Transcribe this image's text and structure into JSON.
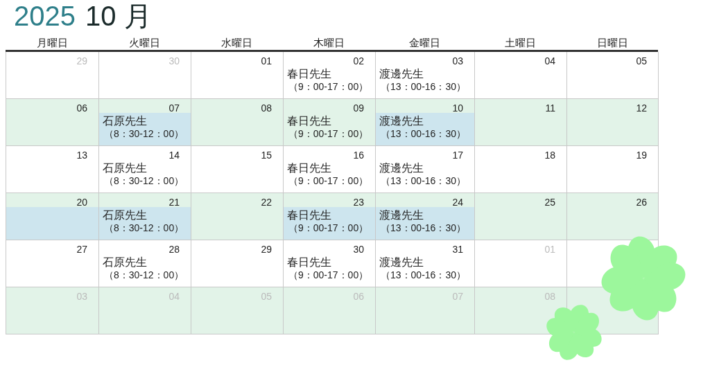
{
  "title": {
    "year": "2025",
    "month": "10 月"
  },
  "weekdays": [
    "月曜日",
    "火曜日",
    "水曜日",
    "木曜日",
    "金曜日",
    "土曜日",
    "日曜日"
  ],
  "weeks": [
    {
      "shaded": false,
      "days": [
        {
          "day": "29",
          "outside": true,
          "highlighted": false
        },
        {
          "day": "30",
          "outside": true,
          "highlighted": false
        },
        {
          "day": "01",
          "outside": false,
          "highlighted": false
        },
        {
          "day": "02",
          "outside": false,
          "highlighted": false,
          "event": {
            "name": "春日先生",
            "time": "（9：00-17：00）"
          }
        },
        {
          "day": "03",
          "outside": false,
          "highlighted": false,
          "event": {
            "name": "渡邊先生",
            "time": "（13：00-16：30）"
          }
        },
        {
          "day": "04",
          "outside": false,
          "highlighted": false
        },
        {
          "day": "05",
          "outside": false,
          "highlighted": false
        }
      ]
    },
    {
      "shaded": true,
      "days": [
        {
          "day": "06",
          "outside": false,
          "highlighted": false
        },
        {
          "day": "07",
          "outside": false,
          "highlighted": true,
          "event": {
            "name": "石原先生",
            "time": "（8：30-12：00）"
          }
        },
        {
          "day": "08",
          "outside": false,
          "highlighted": false
        },
        {
          "day": "09",
          "outside": false,
          "highlighted": false,
          "event": {
            "name": "春日先生",
            "time": "（9：00-17：00）"
          }
        },
        {
          "day": "10",
          "outside": false,
          "highlighted": true,
          "event": {
            "name": "渡邊先生",
            "time": "（13：00-16：30）"
          }
        },
        {
          "day": "11",
          "outside": false,
          "highlighted": false
        },
        {
          "day": "12",
          "outside": false,
          "highlighted": false
        }
      ]
    },
    {
      "shaded": false,
      "days": [
        {
          "day": "13",
          "outside": false,
          "highlighted": false
        },
        {
          "day": "14",
          "outside": false,
          "highlighted": false,
          "event": {
            "name": "石原先生",
            "time": "（8：30-12：00）"
          }
        },
        {
          "day": "15",
          "outside": false,
          "highlighted": false
        },
        {
          "day": "16",
          "outside": false,
          "highlighted": false,
          "event": {
            "name": "春日先生",
            "time": "（9：00-17：00）"
          }
        },
        {
          "day": "17",
          "outside": false,
          "highlighted": false,
          "event": {
            "name": "渡邊先生",
            "time": "（13：00-16：30）"
          }
        },
        {
          "day": "18",
          "outside": false,
          "highlighted": false
        },
        {
          "day": "19",
          "outside": false,
          "highlighted": false
        }
      ]
    },
    {
      "shaded": true,
      "days": [
        {
          "day": "20",
          "outside": false,
          "highlighted": true
        },
        {
          "day": "21",
          "outside": false,
          "highlighted": true,
          "event": {
            "name": "石原先生",
            "time": "（8：30-12：00）"
          }
        },
        {
          "day": "22",
          "outside": false,
          "highlighted": false
        },
        {
          "day": "23",
          "outside": false,
          "highlighted": true,
          "event": {
            "name": "春日先生",
            "time": "（9：00-17：00）"
          }
        },
        {
          "day": "24",
          "outside": false,
          "highlighted": true,
          "event": {
            "name": "渡邊先生",
            "time": "（13：00-16：30）"
          }
        },
        {
          "day": "25",
          "outside": false,
          "highlighted": false
        },
        {
          "day": "26",
          "outside": false,
          "highlighted": false
        }
      ]
    },
    {
      "shaded": false,
      "days": [
        {
          "day": "27",
          "outside": false,
          "highlighted": false
        },
        {
          "day": "28",
          "outside": false,
          "highlighted": false,
          "event": {
            "name": "石原先生",
            "time": "（8：30-12：00）"
          }
        },
        {
          "day": "29",
          "outside": false,
          "highlighted": false
        },
        {
          "day": "30",
          "outside": false,
          "highlighted": false,
          "event": {
            "name": "春日先生",
            "time": "（9：00-17：00）"
          }
        },
        {
          "day": "31",
          "outside": false,
          "highlighted": false,
          "event": {
            "name": "渡邊先生",
            "time": "（13：00-16：30）"
          }
        },
        {
          "day": "01",
          "outside": true,
          "highlighted": false
        },
        {
          "highlighted": false
        }
      ]
    },
    {
      "shaded": true,
      "days": [
        {
          "day": "03",
          "outside": true,
          "highlighted": false
        },
        {
          "day": "04",
          "outside": true,
          "highlighted": false
        },
        {
          "day": "05",
          "outside": true,
          "highlighted": false
        },
        {
          "day": "06",
          "outside": true,
          "highlighted": false
        },
        {
          "day": "07",
          "outside": true,
          "highlighted": false
        },
        {
          "day": "08",
          "outside": true,
          "highlighted": false
        },
        {
          "highlighted": false
        }
      ]
    }
  ]
}
